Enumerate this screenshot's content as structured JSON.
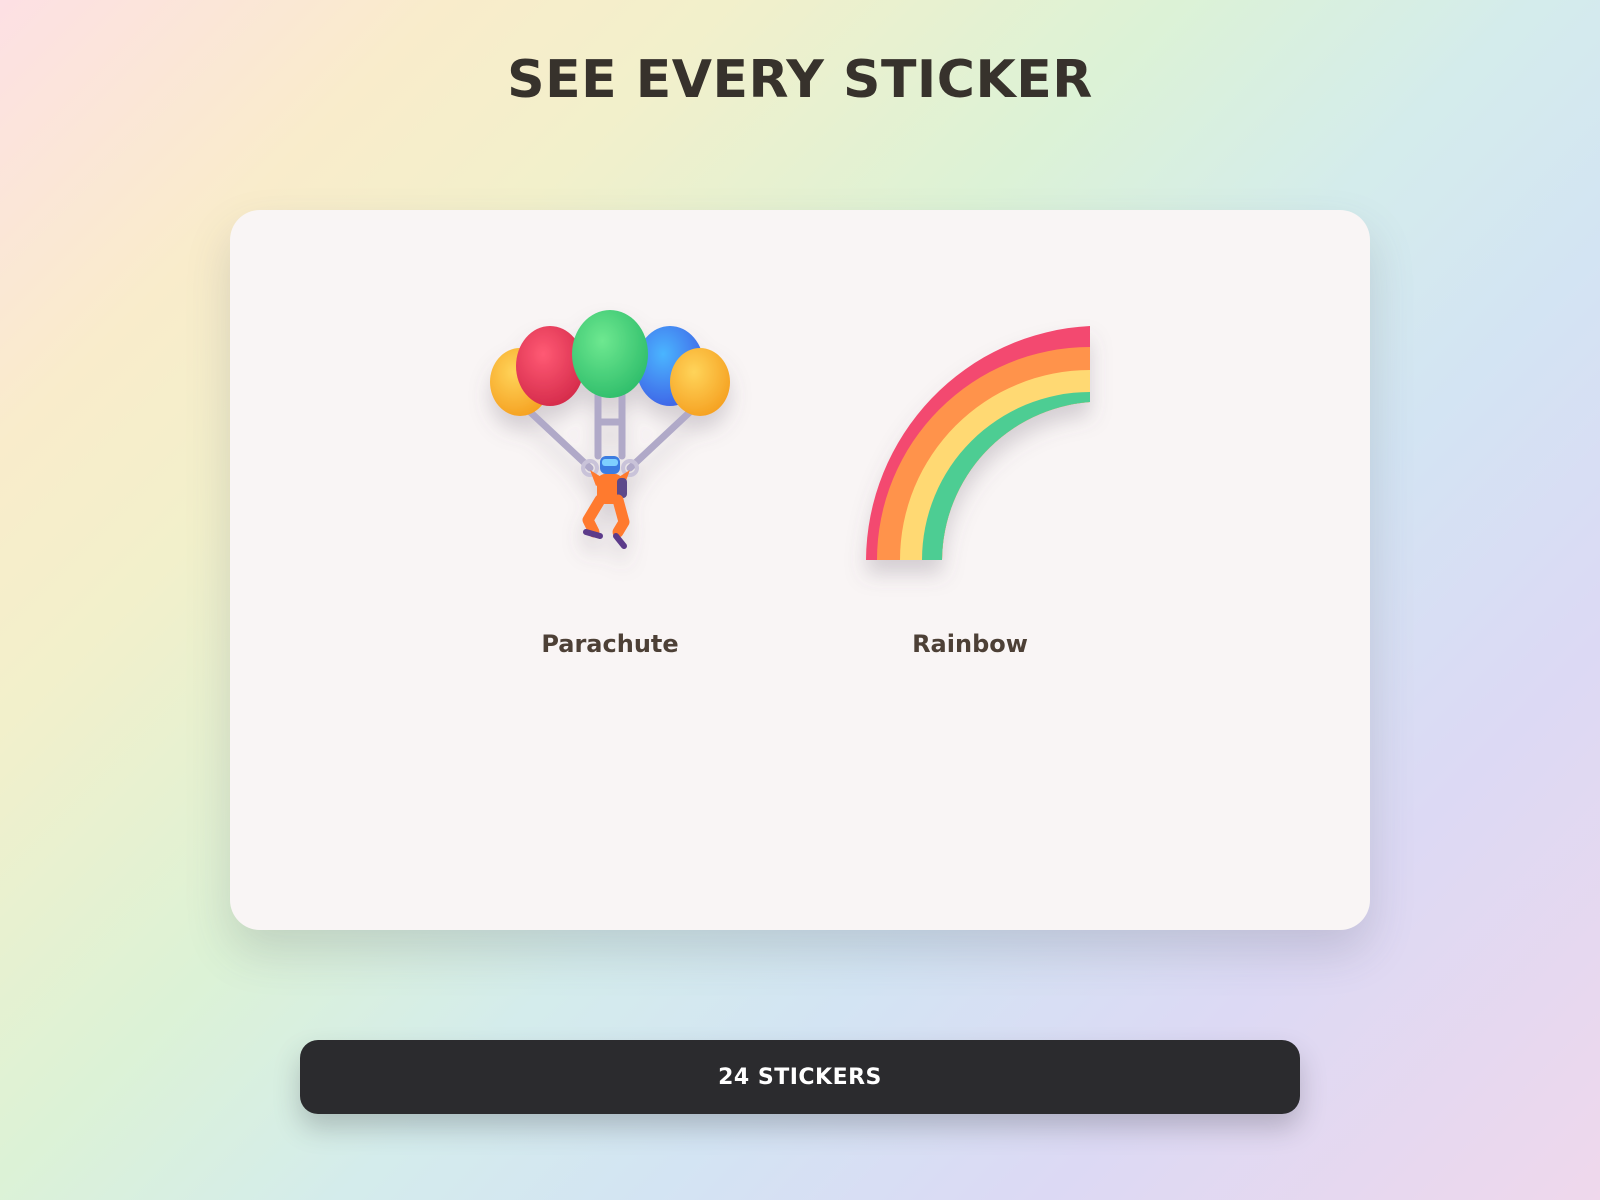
{
  "page": {
    "title": "SEE EVERY STICKER"
  },
  "stickers": [
    {
      "label": "Parachute",
      "icon": "parachute-icon"
    },
    {
      "label": "Rainbow",
      "icon": "rainbow-icon"
    }
  ],
  "footer": {
    "count_label": "24 STICKERS"
  },
  "colors": {
    "title_text": "#37322c",
    "card_background": "#f9f5f5",
    "label_text": "#4d4036",
    "button_background": "#2b2b2e",
    "button_text": "#ffffff"
  }
}
